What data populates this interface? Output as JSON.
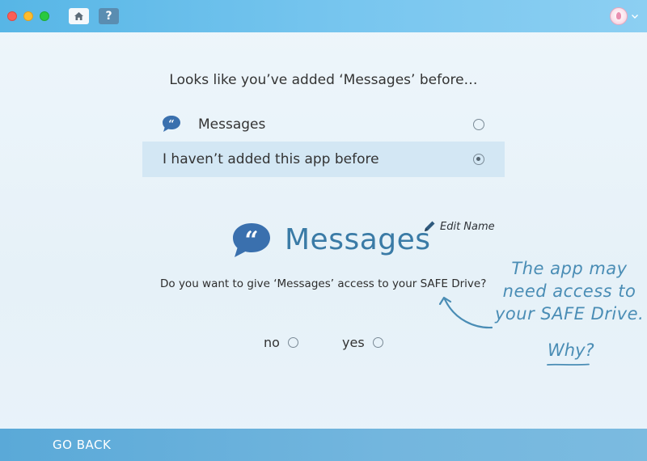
{
  "titlebar": {
    "window_controls": [
      "close",
      "minimize",
      "maximize"
    ],
    "home_icon": "home-icon",
    "help_label": "?",
    "avatar_icon": "unicorn-avatar",
    "menu_icon": "chevron-down-icon"
  },
  "prompt": {
    "question": "Looks like you’ve added ‘Messages’ before…",
    "options": [
      {
        "label": "Messages",
        "icon": "quote-bubble-icon",
        "selected": false
      },
      {
        "label": "I haven’t added this app before",
        "selected": true
      }
    ]
  },
  "app": {
    "name": "Messages",
    "icon": "quote-bubble-icon",
    "edit_label": "Edit Name",
    "access_question": "Do you want to give ‘Messages’ access to your SAFE Drive?",
    "choices": [
      {
        "label": "no",
        "selected": false
      },
      {
        "label": "yes",
        "selected": false
      }
    ]
  },
  "note": {
    "line1": "The app may",
    "line2": "need access to",
    "line3": "your SAFE Drive.",
    "why": "Why?"
  },
  "footer": {
    "go_back": "GO BACK"
  },
  "colors": {
    "accent": "#3a7ba6",
    "titlebar": "#6cc0ec",
    "footer": "#68b0dc",
    "selected_row": "#d3e7f4",
    "note": "#4a8db5"
  }
}
